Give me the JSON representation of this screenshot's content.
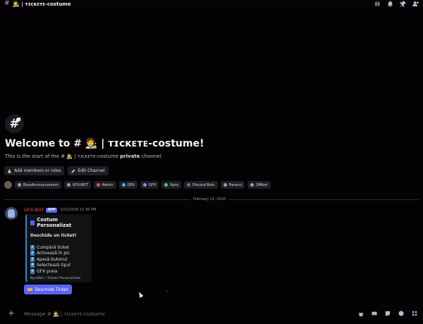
{
  "header": {
    "hash": "#",
    "emoji": "🧑‍🎨",
    "channel_name": "| ᴛɪᴄᴋᴇᴛᴇ-costume"
  },
  "welcome": {
    "hash_symbol": "#",
    "title": "Welcome to # 🧑‍🎨 | ᴛɪᴄᴋᴇᴛᴇ-costume!",
    "sub_prefix": "This is the start of the # 🧑‍🎨 | ᴛɪᴄᴋᴇᴛᴇ-costume",
    "sub_bold": "private",
    "sub_suffix": "channel.",
    "add_members_label": "Add members or roles",
    "edit_channel_label": "Edit Channel"
  },
  "roles": [
    {
      "name": "BossAnnouncement",
      "color": "#9aa0a6"
    },
    {
      "name": "GFX-BOT",
      "color": "#9aa0a6"
    },
    {
      "name": "Admin",
      "color": "#e0584f"
    },
    {
      "name": "DEV",
      "color": "#3bb4e8"
    },
    {
      "name": "GFX",
      "color": "#9b84ec"
    },
    {
      "name": "Nyra",
      "color": "#57c27a"
    },
    {
      "name": "Discord Bots",
      "color": "#6d6f78"
    },
    {
      "name": "Fierarul",
      "color": "#9aa0a6"
    },
    {
      "name": "DMbot",
      "color": "#9aa0a6"
    }
  ],
  "divider_date": "February 11, 2026",
  "message": {
    "author": "GFX-BOT",
    "app_tag": "APP",
    "timestamp": "2/11/2026 11:36 PM",
    "embed": {
      "title": "Costum Personalizat",
      "description": "Deschide un ticket!",
      "steps": [
        {
          "num": "1",
          "text": "Cumpără ticket"
        },
        {
          "num": "2",
          "text": "Activează în joc"
        },
        {
          "num": "3",
          "text": "Apasă butonul"
        },
        {
          "num": "4",
          "text": "Selectează tipul"
        },
        {
          "num": "5",
          "text": "GFX preia"
        }
      ],
      "footer": "NyraBot • Tickete Personalizate"
    },
    "button_label": "Deschide Ticket"
  },
  "composer": {
    "plus": "+",
    "placeholder": "Message # 🧑‍🎨 | ᴛɪᴄᴋᴇᴛᴇ-costume"
  },
  "colors": {
    "accent": "#5865f2",
    "embed_border": "#3b82c4",
    "author": "#e0584f",
    "background": "#040204"
  }
}
